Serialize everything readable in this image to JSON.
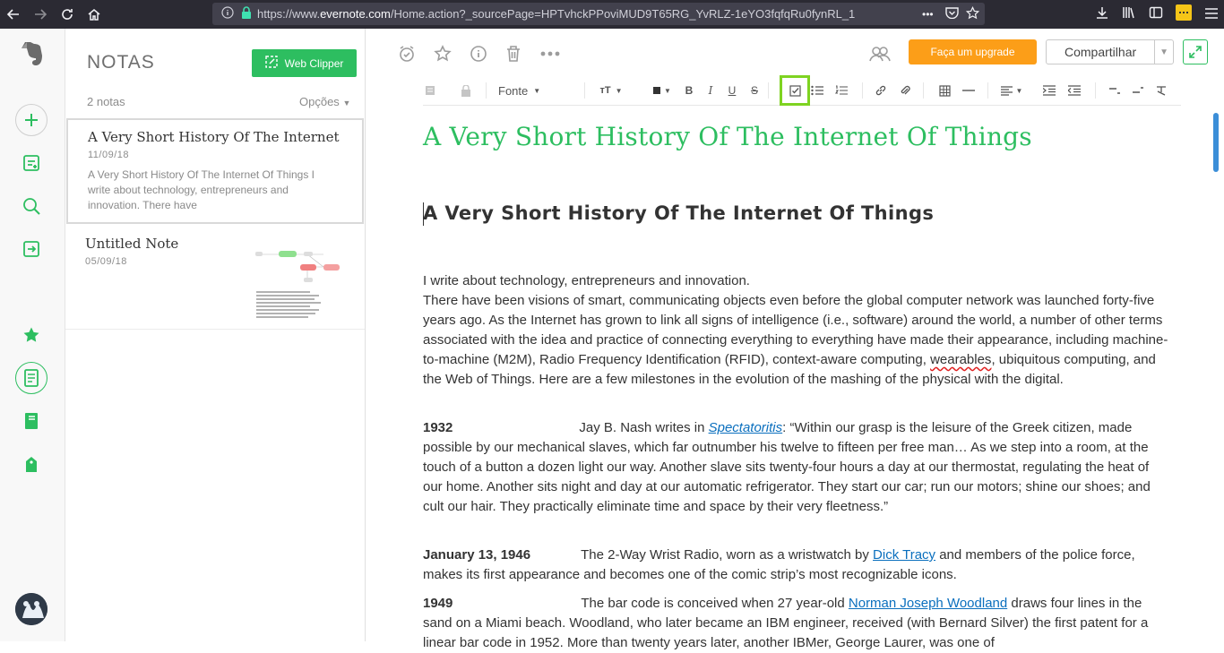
{
  "browser": {
    "url_prefix": "https://www.",
    "url_domain": "evernote.com",
    "url_rest": "/Home.action?_sourcePage=HPTvhckPPoviMUD9T65RG_YvRLZ-1eYO3fqfqRu0fynRL_1",
    "more_label": "•••"
  },
  "notes_panel": {
    "title": "NOTAS",
    "web_clipper_label": "Web Clipper",
    "count": "2 notas",
    "options_label": "Opções",
    "notes": [
      {
        "title": "A Very Short History Of The Internet",
        "date": "11/09/18",
        "snippet": "A Very Short History Of The Internet Of Things I write about technology, entrepreneurs and innovation. There have"
      },
      {
        "title": "Untitled Note",
        "date": "05/09/18",
        "snippet": ""
      }
    ]
  },
  "editor": {
    "upgrade_label": "Faça um upgrade",
    "share_label": "Compartilhar",
    "font_label": "Fonte",
    "note_title": "A Very Short History Of The Internet Of Things",
    "heading": "A Very Short History Of The Internet Of Things",
    "intro_line": "I write about technology, entrepreneurs and innovation.",
    "intro_p1": "There have been visions of smart, communicating objects even before the global computer network was launched forty-five years ago. As the Internet has grown to link all signs of intelligence (i.e., software) around the world, a number of other terms associated with the idea and practice of connecting everything to everything have made their appearance, including machine-to-machine (M2M), Radio Frequency Identification (RFID), context-aware computing, ",
    "intro_spell": "wearables",
    "intro_p2": ", ubiquitous computing, and the Web of Things. Here are a few milestones in the evolution of the mashing of the physical with the digital.",
    "e1932_label": "1932",
    "e1932_a": "Jay B. Nash writes in ",
    "e1932_link": "Spectatoritis",
    "e1932_b": ": “Within our grasp is the leisure of the Greek citizen, made possible by our mechanical slaves, which far outnumber his twelve to fifteen per free man… As we step into a room, at the touch of a button a dozen light our way. Another slave sits twenty-four hours a day at our thermostat, regulating the heat of our home. Another sits night and day at our automatic refrigerator. They start our car; run our motors; shine our shoes; and cult our hair. They practically eliminate time and space by their very fleetness.”",
    "e1946_label": "January 13, 1946",
    "e1946_a": "The 2-Way Wrist Radio, worn as a wristwatch by ",
    "e1946_link": "Dick Tracy",
    "e1946_b": " and members of the police force, makes its first appearance and becomes one of the comic strip’s most recognizable icons.",
    "e1949_label": "1949",
    "e1949_a": "The bar code is conceived when 27 year-old ",
    "e1949_link": "Norman Joseph Woodland",
    "e1949_b": " draws four lines in the sand on a Miami beach. Woodland, who later became an IBM engineer, received (with Bernard Silver) the first patent for a linear bar code in 1952. More than twenty years later, another IBMer, George Laurer, was one of"
  },
  "colors": {
    "brand_green": "#2dbe60",
    "upgrade_orange": "#fc9e18",
    "highlight_green": "#7ed321",
    "link_blue": "#0a6fbe"
  }
}
